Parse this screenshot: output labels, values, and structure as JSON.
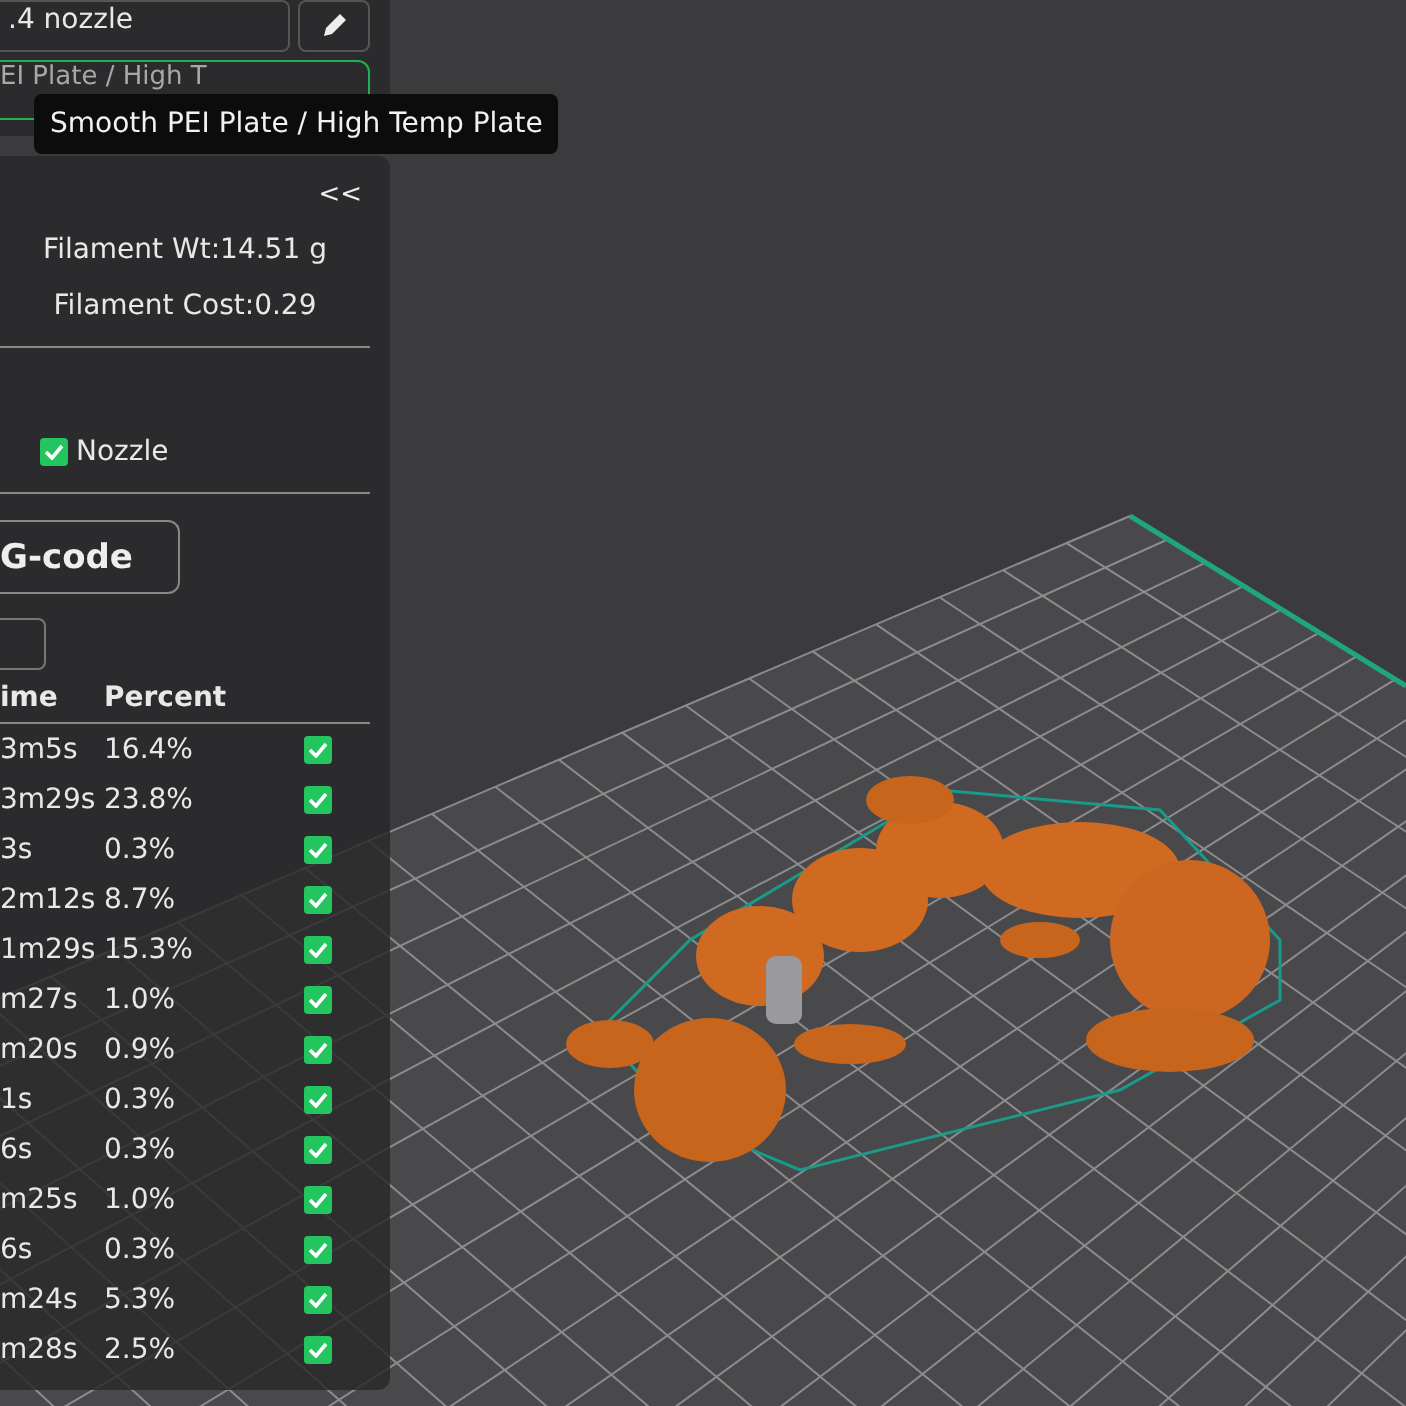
{
  "printer": {
    "nozzle": ".4 nozzle",
    "plate": "EI Plate / High T"
  },
  "tooltip": "Smooth PEI Plate / High Temp Plate",
  "summary": {
    "collapse": "<<",
    "weight": "Filament Wt:14.51 g",
    "cost": "Filament Cost:0.29"
  },
  "options": [
    {
      "label": "Nozzle",
      "checked": true
    }
  ],
  "export_button": "G-code",
  "table": {
    "columns": [
      "ime",
      "Percent"
    ],
    "rows": [
      {
        "time": "3m5s",
        "percent": "16.4%",
        "checked": true
      },
      {
        "time": "3m29s",
        "percent": "23.8%",
        "checked": true
      },
      {
        "time": "3s",
        "percent": "0.3%",
        "checked": true
      },
      {
        "time": "2m12s",
        "percent": "8.7%",
        "checked": true
      },
      {
        "time": "1m29s",
        "percent": "15.3%",
        "checked": true
      },
      {
        "time": "m27s",
        "percent": "1.0%",
        "checked": true
      },
      {
        "time": "m20s",
        "percent": "0.9%",
        "checked": true
      },
      {
        "time": "1s",
        "percent": "0.3%",
        "checked": true
      },
      {
        "time": "6s",
        "percent": "0.3%",
        "checked": true
      },
      {
        "time": "m25s",
        "percent": "1.0%",
        "checked": true
      },
      {
        "time": "6s",
        "percent": "0.3%",
        "checked": true
      },
      {
        "time": "m24s",
        "percent": "5.3%",
        "checked": true
      },
      {
        "time": "m28s",
        "percent": "2.5%",
        "checked": true
      }
    ]
  }
}
